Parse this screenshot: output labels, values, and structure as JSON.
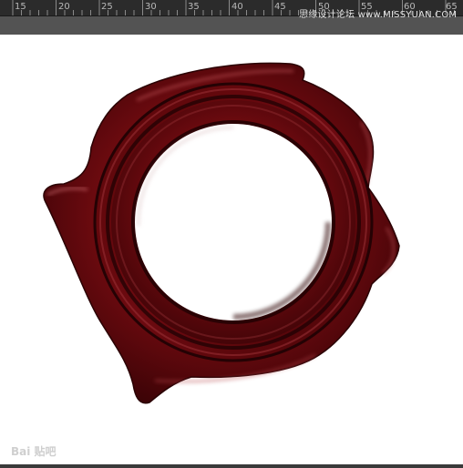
{
  "ruler": {
    "labels": [
      "15",
      "20",
      "25",
      "30",
      "35",
      "40",
      "45",
      "50",
      "55",
      "60",
      "65"
    ]
  },
  "watermark_top": "思缘设计论坛 www.MISSYUAN.COM",
  "watermark_bottom": "Bai 贴吧",
  "icons": {
    "seal": "wax-seal-ring"
  },
  "colors": {
    "wax_dark": "#3a0306",
    "wax_mid": "#6b0a0f",
    "wax_light": "#9c2a2f",
    "ruler_bg": "#2b2b2b"
  }
}
